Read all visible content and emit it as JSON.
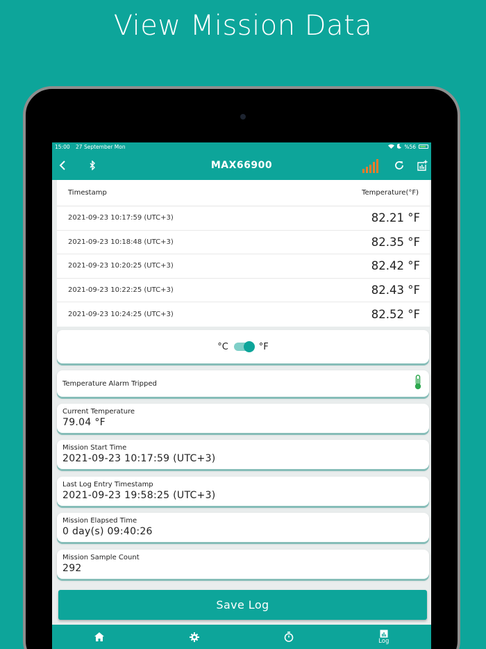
{
  "promo": {
    "title": "View Mission Data"
  },
  "statusbar": {
    "time": "15:00",
    "date": "27 September Mon",
    "battery": "%56"
  },
  "appbar": {
    "title": "MAX66900"
  },
  "table": {
    "headers": {
      "timestamp": "Timestamp",
      "temperature": "Temperature(°F)"
    },
    "rows": [
      {
        "timestamp": "2021-09-23 10:17:59 (UTC+3)",
        "value": "82.21 °F"
      },
      {
        "timestamp": "2021-09-23 10:18:48 (UTC+3)",
        "value": "82.35 °F"
      },
      {
        "timestamp": "2021-09-23 10:20:25 (UTC+3)",
        "value": "82.42 °F"
      },
      {
        "timestamp": "2021-09-23 10:22:25 (UTC+3)",
        "value": "82.43 °F"
      },
      {
        "timestamp": "2021-09-23 10:24:25 (UTC+3)",
        "value": "82.52 °F"
      }
    ]
  },
  "unit_toggle": {
    "celsius": "°C",
    "fahrenheit": "°F",
    "selected": "°F"
  },
  "alarm": {
    "label": "Temperature Alarm Tripped"
  },
  "info": {
    "current_temperature": {
      "label": "Current Temperature",
      "value": "79.04 °F"
    },
    "mission_start": {
      "label": "Mission Start Time",
      "value": "2021-09-23 10:17:59 (UTC+3)"
    },
    "last_log": {
      "label": "Last Log Entry Timestamp",
      "value": "2021-09-23 19:58:25 (UTC+3)"
    },
    "elapsed": {
      "label": "Mission Elapsed Time",
      "value": "0 day(s) 09:40:26"
    },
    "sample_count": {
      "label": "Mission Sample Count",
      "value": "292"
    }
  },
  "save_button": {
    "label": "Save Log"
  },
  "bottom_nav": {
    "log_label": "Log"
  },
  "colors": {
    "accent": "#0da59a",
    "signal": "#f07a2a",
    "alarm_icon": "#2fa84f"
  }
}
